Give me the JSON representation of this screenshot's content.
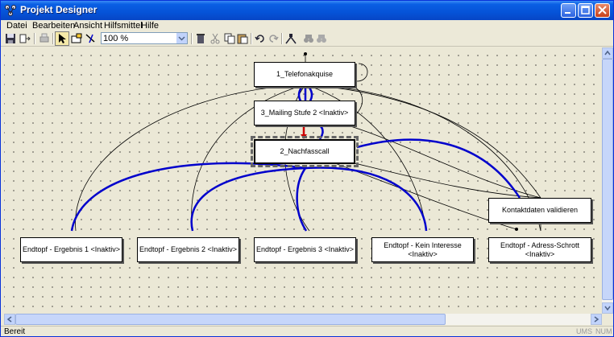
{
  "window": {
    "title": "Projekt Designer"
  },
  "menu": {
    "items": [
      "Datei",
      "Bearbeiten",
      "Ansicht",
      "Hilfsmittel",
      "Hilfe"
    ]
  },
  "toolbar": {
    "zoom_value": "100 %",
    "icons": [
      "save-icon",
      "export-icon",
      "print-icon",
      "pointer-icon",
      "frame-icon",
      "connector-icon",
      "delete-icon",
      "cut-icon",
      "copy-icon",
      "paste-icon",
      "undo-icon",
      "redo-icon",
      "layout-icon",
      "find-icon",
      "find-next-icon"
    ]
  },
  "diagram": {
    "nodes": {
      "telefonakquise": "1_Telefonakquise",
      "mailing": "3_Mailing Stufe 2 <Inaktiv>",
      "nachfasscall": "2_Nachfasscall",
      "kontaktdaten": "Kontaktdaten validieren",
      "ergebnis1": "Endtopf - Ergebnis 1 <Inaktiv>",
      "ergebnis2": "Endtopf - Ergebnis 2 <Inaktiv>",
      "ergebnis3": "Endtopf - Ergebnis 3 <Inaktiv>",
      "kein_interesse": "Endtopf - Kein Interesse\n<Inaktiv>",
      "adress_schrott": "Endtopf - Adress-Schrott\n<Inaktiv>"
    },
    "colors": {
      "active_edge": "#0000cc",
      "inactive_edge": "#000000",
      "highlight_edge": "#cc0000"
    }
  },
  "statusbar": {
    "text": "Bereit",
    "indicators": [
      "UMS",
      "NUM"
    ]
  }
}
